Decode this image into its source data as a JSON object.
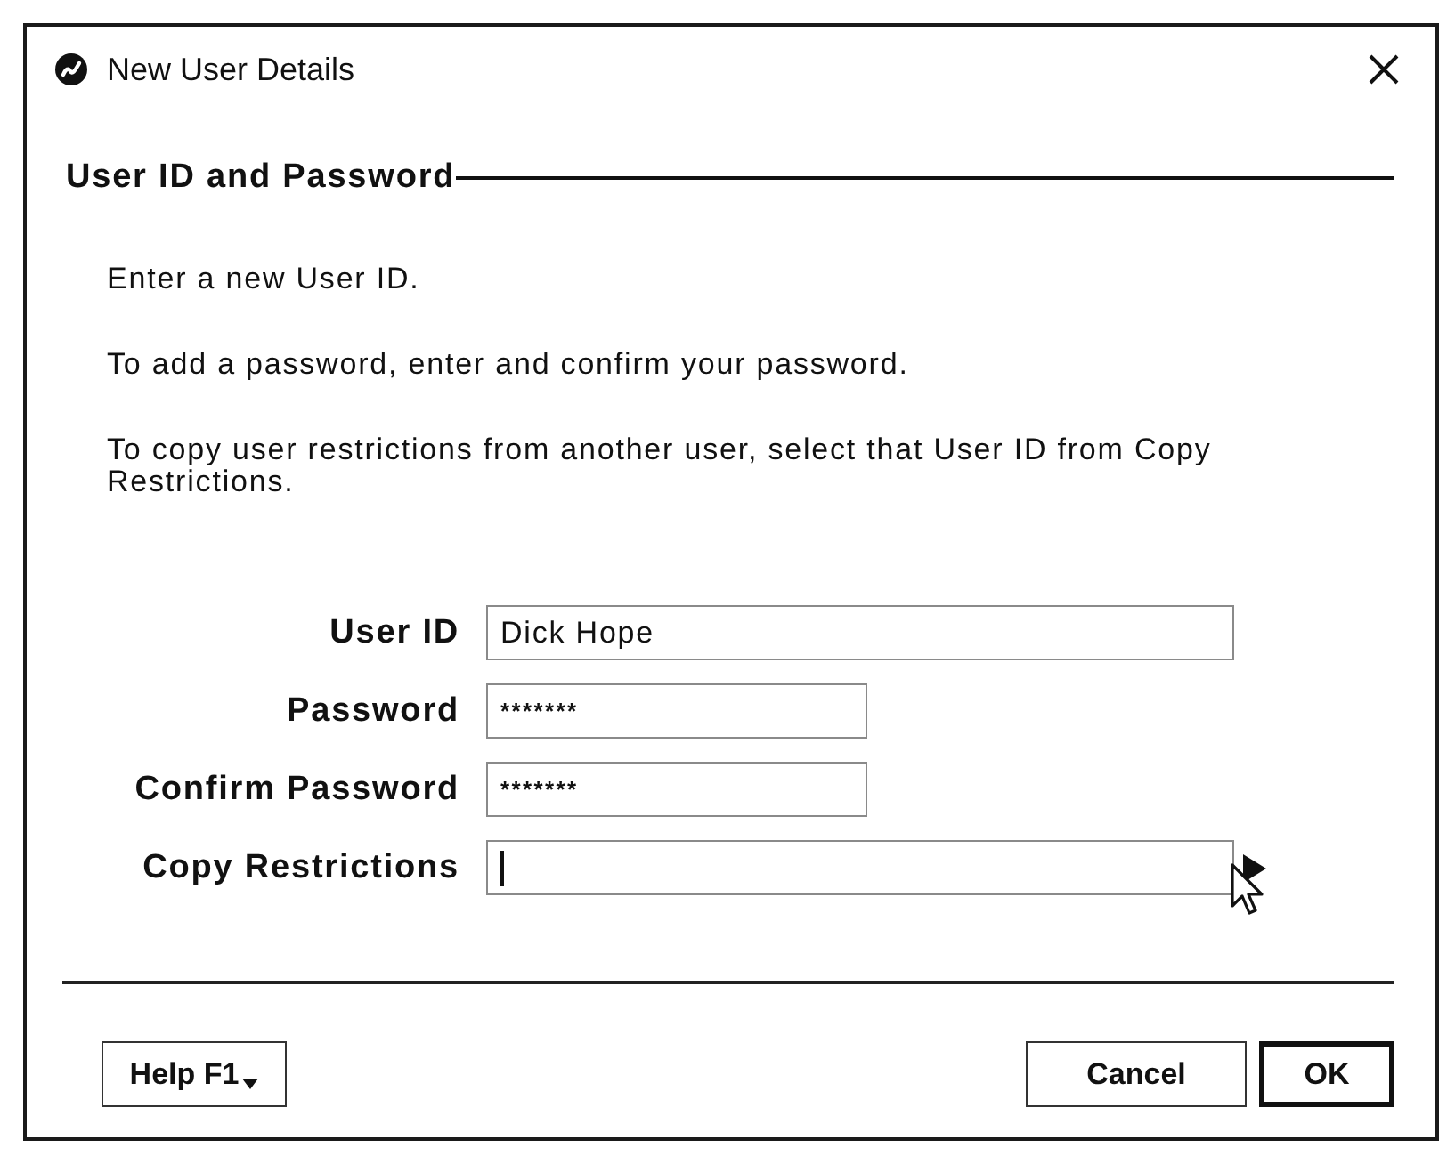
{
  "window": {
    "title": "New User Details"
  },
  "section": {
    "title": "User ID and Password"
  },
  "instructions": [
    "Enter a new User ID.",
    "To add a password, enter and confirm your password.",
    "To copy user restrictions from another user, select that User ID from Copy Restrictions."
  ],
  "fields": [
    {
      "label": "User ID",
      "kind": "text",
      "value": "Dick Hope",
      "focused": false
    },
    {
      "label": "Password",
      "kind": "password",
      "value": "*******",
      "focused": false
    },
    {
      "label": "Confirm Password",
      "kind": "password",
      "value": "*******",
      "focused": false
    },
    {
      "label": "Copy Restrictions",
      "kind": "dropdown",
      "focused": true
    }
  ],
  "buttons": [
    {
      "label": "Help F1",
      "kind": "menu",
      "default": false
    },
    {
      "label": "Cancel",
      "kind": "push",
      "default": false
    },
    {
      "label": "OK",
      "kind": "push",
      "default": true
    }
  ]
}
